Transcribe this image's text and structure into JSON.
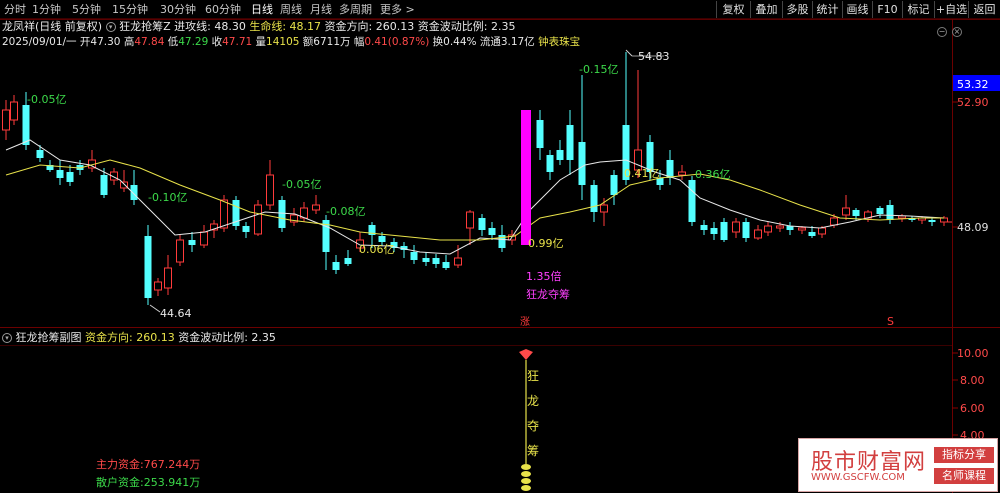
{
  "toolbar": {
    "tabs": [
      "分时",
      "1分钟",
      "5分钟",
      "15分钟",
      "30分钟",
      "60分钟",
      "日线",
      "周线",
      "月线",
      "多周期",
      "更多 >"
    ],
    "active_tab": "日线",
    "right_buttons": [
      "复权",
      "叠加",
      "多股",
      "统计",
      "画线",
      "F10",
      "标记",
      "+自选",
      "返回"
    ]
  },
  "info": {
    "stock_name": "龙凤祥(日线 前复权)",
    "indicator_name": "狂龙抢筹Z",
    "entry_line_label": "进攻线: 48.30",
    "life_line_label": "生命线: 48.17",
    "fund_direction_label": "资金方向: 260.13",
    "fund_ratio_label": "资金波动比例: 2.35",
    "date": "2025/09/01/一",
    "open_label": "开",
    "open": "47.30",
    "high_label": "高",
    "high": "47.84",
    "low_label": "低",
    "low": "47.29",
    "close_label": "收",
    "close": "47.71",
    "volume_label": "量",
    "volume": "14105",
    "amount_label": "额",
    "amount": "6711万",
    "change_label": "幅",
    "change": "0.41(0.87%)",
    "turnover_label": "换",
    "turnover": "0.44%",
    "float_label": "流通",
    "float": "3.17亿",
    "concept": "钟表珠宝"
  },
  "price_axis": {
    "current_price": "53.32",
    "ticks": [
      "52.90",
      "48.09"
    ]
  },
  "annotations": {
    "high_price": "54.83",
    "low_price": "44.64",
    "flows": [
      "-0.05亿",
      "-0.10亿",
      "-0.05亿",
      "-0.08亿",
      "0.06亿",
      "0.99亿",
      "-0.15亿",
      "0.41亿",
      "0.36亿"
    ],
    "volume_ratio": "1.35倍",
    "signal_text": "狂龙夺筹",
    "rise_mark": "涨",
    "s_mark": "S"
  },
  "sub_panel": {
    "title": "狂龙抢筹副图",
    "fund_direction_label": "资金方向: 260.13",
    "fund_ratio_label": "资金波动比例: 2.35",
    "y_ticks": [
      "10.00",
      "8.00",
      "6.00",
      "4.00"
    ],
    "vertical_chars": [
      "狂",
      "龙",
      "夺",
      "筹"
    ],
    "main_fund": "主力资金:767.244万",
    "retail_fund": "散户资金:253.941万"
  },
  "watermark": {
    "site_name": "股市财富网",
    "site_url": "WWW.GSCFW.COM",
    "badge1": "指标分享",
    "badge2": "名师课程"
  },
  "colors": {
    "up": "#ff3b3b",
    "down": "#54ffff",
    "signal": "#ff00ff",
    "ma_short": "#e8e8e8",
    "ma_long": "#e8e24a",
    "axis_red": "#6b0000"
  }
}
